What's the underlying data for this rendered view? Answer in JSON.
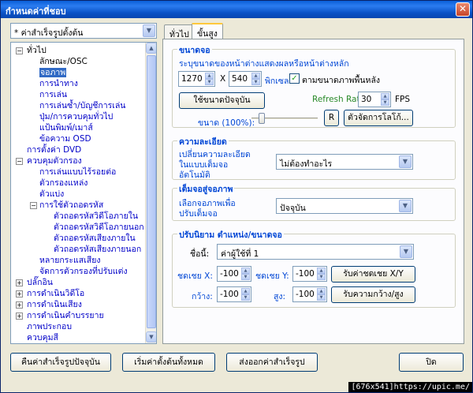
{
  "window": {
    "title": "กำหนดค่าที่ชอบ",
    "close": "✕"
  },
  "preset_combo": {
    "value": "* ค่าสำเร็จรูปตั้งต้น"
  },
  "tree": {
    "items": [
      {
        "label": "ทั่วไป"
      },
      {
        "label": "ลักษณะ/OSC"
      },
      {
        "label": "จอภาพ"
      },
      {
        "label": "การนำทาง"
      },
      {
        "label": "การเล่น"
      },
      {
        "label": "การเล่นซ้ำ/บัญชีการเล่น"
      },
      {
        "label": "ปุ่ม/การควบคุมทั่วไป"
      },
      {
        "label": "แป้นพิมพ์/เมาส์"
      },
      {
        "label": "ข้อความ OSD"
      },
      {
        "label": "การตั้งค่า DVD"
      },
      {
        "label": "ควบคุมตัวกรอง"
      },
      {
        "label": "การเล่นแบบไร้รอยต่อ"
      },
      {
        "label": "ตัวกรองแหล่ง"
      },
      {
        "label": "ตัวแบ่ง"
      },
      {
        "label": "การใช้ตัวถอดรหัส"
      },
      {
        "label": "ตัวถอดรหัสวิดีโอภายใน"
      },
      {
        "label": "ตัวถอดรหัสวิดีโอภายนอก"
      },
      {
        "label": "ตัวถอดรหัสเสียงภายใน"
      },
      {
        "label": "ตัวถอดรหัสเสียงภายนอก"
      },
      {
        "label": "หลายกระแสเสียง"
      },
      {
        "label": "จัดการตัวกรองที่ปรับแต่ง"
      },
      {
        "label": "ปลั๊กอิน"
      },
      {
        "label": "การดำเนินวิดีโอ"
      },
      {
        "label": "การดำเนินเสียง"
      },
      {
        "label": "การดำเนินคำบรรยาย"
      },
      {
        "label": "ภาพประกอบ"
      },
      {
        "label": "ควบคุมสี"
      }
    ]
  },
  "tabs": {
    "general": "ทั่วไป",
    "advanced": "ขั้นสูง"
  },
  "size_group": {
    "title": "ขนาดจอ",
    "desc": "ระบุขนาดของหน้าต่างแสดงผลหรือหน้าต่างหลัก",
    "width": "1270",
    "x": "X",
    "height": "540",
    "unit": "พิกเซล",
    "bg_check_label": "ตามขนาดภาพพื้นหลัง",
    "use_current": "ใช้ขนาดปัจจุบัน",
    "refresh_label": "Refresh Rate:",
    "refresh_value": "30",
    "fps": "FPS",
    "scale_label": "ขนาด (100%):",
    "scale_fraction": 0.12,
    "r_button": "R",
    "logo_button": "ตัวจัดการโลโก้..."
  },
  "res_group": {
    "title": "ความละเอียด",
    "label": "เปลี่ยนความละเอียด ในแบบเต็มจอ อัตโนมัติ",
    "label_l1": "เปลี่ยนความละเอียด",
    "label_l2": "ในแบบเต็มจอ",
    "label_l3": "อัตโนมัติ",
    "value": "ไม่ต้องทำอะไร"
  },
  "fit_group": {
    "title": "เต็มจอสู่จอภาพ",
    "label_l1": "เลือกจอภาพเพื่อ",
    "label_l2": "ปรับเต็มจอ",
    "value": "ปัจจุบัน"
  },
  "adjust_group": {
    "title": "ปรับนิยาม ตำแหน่ง/ขนาดจอ",
    "name_label": "ชื่อนี้:",
    "name_value": "ค่าผู้ใช้ที่ 1",
    "offx_label": "ชดเชย X:",
    "offx_value": "-100",
    "offy_label": "ชดเชย Y:",
    "offy_value": "-100",
    "offset_button": "รับค่าชดเชย X/Y",
    "w_label": "กว้าง:",
    "w_value": "-100",
    "h_label": "สูง:",
    "h_value": "-100",
    "size_button": "รับความกว้าง/สูง"
  },
  "footer": {
    "load_preset": "คืนค่าสำเร็จรูปปัจจุบัน",
    "reset_all": "เริ่มค่าตั้งต้นทั้งหมด",
    "export": "ส่งออกค่าสำเร็จรูป",
    "close": "ปิด"
  },
  "status": "[676x541]https://upic.me/"
}
